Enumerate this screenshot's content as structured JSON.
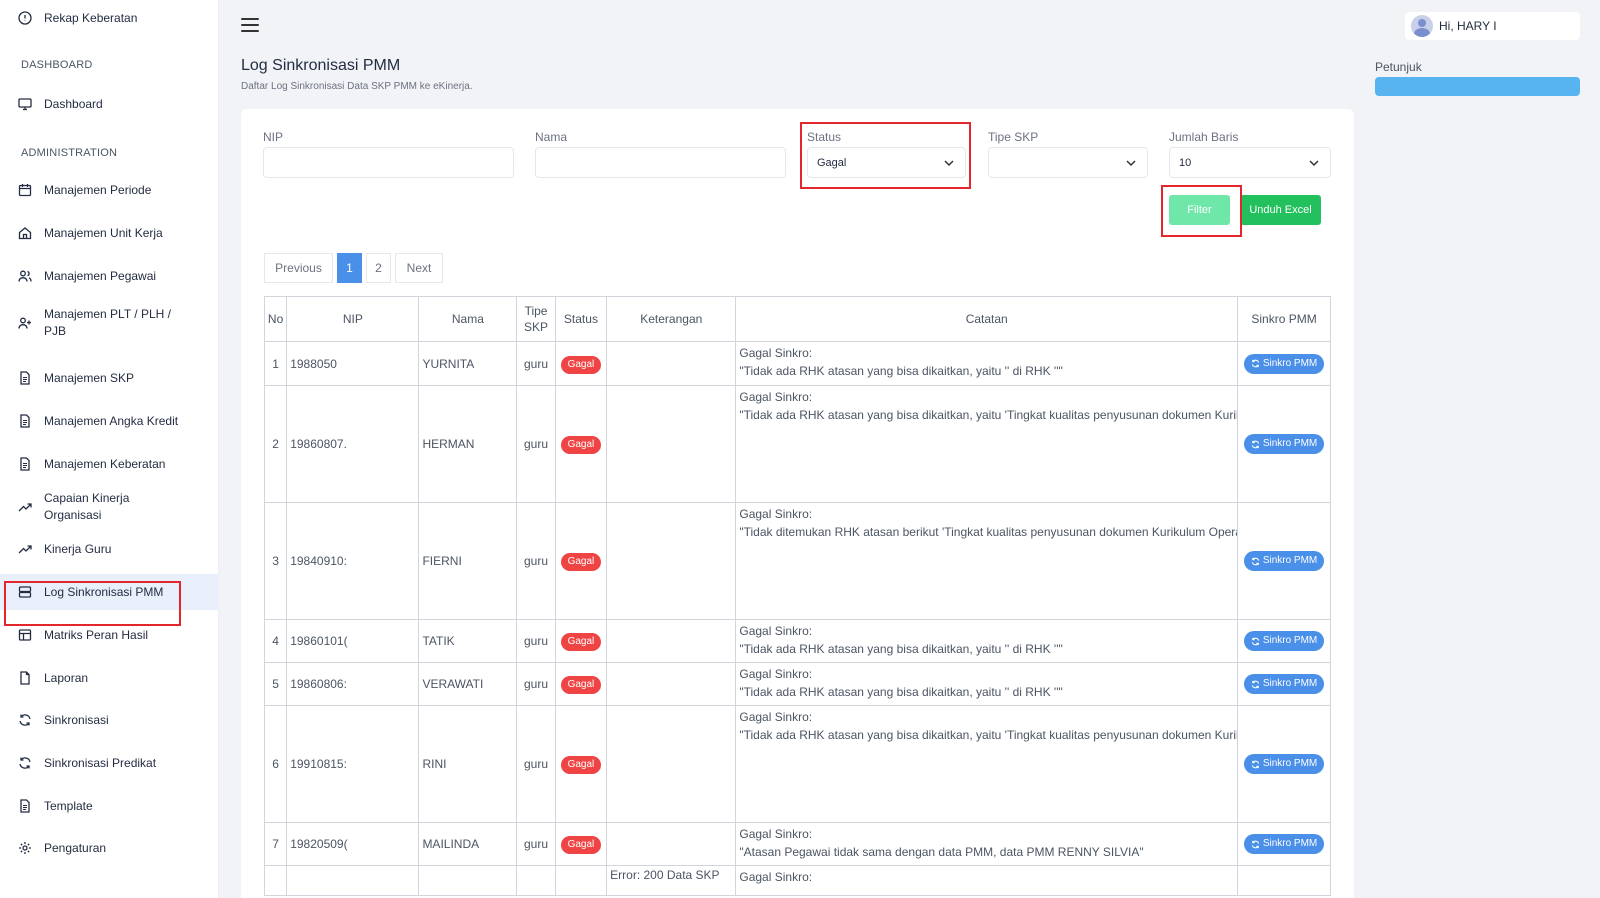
{
  "sidebar": {
    "items": [
      {
        "label": "Rekap Keberatan",
        "icon": "alert-circle-icon"
      },
      {
        "label": "Dashboard",
        "icon": "monitor-icon"
      },
      {
        "label": "Manajemen Periode",
        "icon": "calendar-icon"
      },
      {
        "label": "Manajemen Unit Kerja",
        "icon": "home-icon"
      },
      {
        "label": "Manajemen Pegawai",
        "icon": "users-icon"
      },
      {
        "label": "Manajemen PLT / PLH / PJB",
        "icon": "user-plus-icon"
      },
      {
        "label": "Manajemen SKP",
        "icon": "file-text-icon"
      },
      {
        "label": "Manajemen Angka Kredit",
        "icon": "file-text-icon"
      },
      {
        "label": "Manajemen Keberatan",
        "icon": "file-text-icon"
      },
      {
        "label": "Capaian Kinerja Organisasi",
        "icon": "trending-up-icon"
      },
      {
        "label": "Kinerja Guru",
        "icon": "trending-up-icon"
      },
      {
        "label": "Log Sinkronisasi PMM",
        "icon": "server-icon"
      },
      {
        "label": "Matriks Peran Hasil",
        "icon": "table-icon"
      },
      {
        "label": "Laporan",
        "icon": "file-icon"
      },
      {
        "label": "Sinkronisasi",
        "icon": "refresh-icon"
      },
      {
        "label": "Sinkronisasi Predikat",
        "icon": "refresh-icon"
      },
      {
        "label": "Template",
        "icon": "file-text-icon"
      },
      {
        "label": "Pengaturan",
        "icon": "gear-icon"
      }
    ],
    "sections": {
      "dashboard": "DASHBOARD",
      "administration": "ADMINISTRATION"
    }
  },
  "header": {
    "user_greeting": "Hi, HARY I"
  },
  "page": {
    "title": "Log Sinkronisasi PMM",
    "subtitle": "Daftar Log Sinkronisasi Data SKP PMM ke eKinerja.",
    "petunjuk": "Petunjuk"
  },
  "filters": {
    "nip_label": "NIP",
    "nip_value": "",
    "nama_label": "Nama",
    "nama_value": "",
    "status_label": "Status",
    "status_value": "Gagal",
    "tipe_label": "Tipe SKP",
    "tipe_value": "",
    "jumlah_label": "Jumlah Baris",
    "jumlah_value": "10",
    "filter_button": "Filter",
    "excel_button": "Unduh Excel"
  },
  "pagination": {
    "previous": "Previous",
    "pages": [
      "1",
      "2"
    ],
    "next": "Next",
    "active_page": "1"
  },
  "table": {
    "headers": {
      "no": "No",
      "nip": "NIP",
      "nama": "Nama",
      "tipe": "Tipe SKP",
      "status": "Status",
      "keterangan": "Keterangan",
      "catatan": "Catatan",
      "sinkro": "Sinkro PMM"
    },
    "sinkro_label": "Sinkro PMM",
    "rows": [
      {
        "no": "1",
        "nip": "1988050",
        "nama": "YURNITA",
        "tipe": "guru",
        "status": "Gagal",
        "keterangan": "",
        "catatan_title": "Gagal Sinkro:",
        "catatan": "\"Tidak ada RHK atasan yang bisa dikaitkan, yaitu '' di RHK ''\""
      },
      {
        "no": "2",
        "nip": "19860807.",
        "nama": "HERMAN",
        "tipe": "guru",
        "status": "Gagal",
        "keterangan": "",
        "catatan_title": "Gagal Sinkro:",
        "catatan": "\"Tidak ada RHK atasan yang bisa dikaitkan, yaitu 'Tingkat kualitas penyusunan dokumen Kurikulum Operasional Satuan Pendidikan (KOSP) yang berorientasi pada peningkatan pembelajaran sesuai standar yang digunakan' di RHK 'Tersusunnya Kurikulum Operasional Satuan Pendidikan (KOSP) sebagai acuan dalam peningkatan pembelajaran'\""
      },
      {
        "no": "3",
        "nip": "19840910:",
        "nama": "FIERNI",
        "tipe": "guru",
        "status": "Gagal",
        "keterangan": "",
        "catatan_title": "Gagal Sinkro:",
        "catatan": "\"Tidak ditemukan RHK atasan berikut 'Tingkat kualitas penyusunan dokumen Kurikulum Operasional Satuan Pendidikan (KOSP) yang berorientasi pada peningkatan pembelajaran sesuai standar yang digunakan' di RHK 'Tersusunnya Kurikulum Operasional Satuan Pendidikan (KOSP) sebagai acuan dalam peningkatan pembelajaran'\""
      },
      {
        "no": "4",
        "nip": "19860101(",
        "nama": "TATIK",
        "tipe": "guru",
        "status": "Gagal",
        "keterangan": "",
        "catatan_title": "Gagal Sinkro:",
        "catatan": "\"Tidak ada RHK atasan yang bisa dikaitkan, yaitu '' di RHK ''\""
      },
      {
        "no": "5",
        "nip": "19860806:",
        "nama": "VERAWATI",
        "tipe": "guru",
        "status": "Gagal",
        "keterangan": "",
        "catatan_title": "Gagal Sinkro:",
        "catatan": "\"Tidak ada RHK atasan yang bisa dikaitkan, yaitu '' di RHK ''\""
      },
      {
        "no": "6",
        "nip": "19910815:",
        "nama": "RINI",
        "tipe": "guru",
        "status": "Gagal",
        "keterangan": "",
        "catatan_title": "Gagal Sinkro:",
        "catatan": "\"Tidak ada RHK atasan yang bisa dikaitkan, yaitu 'Tingkat kualitas penyusunan dokumen Kurikulum Operasional Satuan Pendidikan (KOSP) yang berorientasi pada peningkatan pembelajaran sesuai standar yang digunakan' di RHK 'Tersusunnya Kurikulum Operasional Satuan Pendidikan (KOSP) sebagai acuan dalam peningkatan pembelajaran'\""
      },
      {
        "no": "7",
        "nip": "19820509(",
        "nama": "MAILINDA",
        "tipe": "guru",
        "status": "Gagal",
        "keterangan": "",
        "catatan_title": "Gagal Sinkro:",
        "catatan": "\"Atasan Pegawai tidak sama dengan data PMM, data PMM RENNY SILVIA\""
      },
      {
        "no": "",
        "nip": "",
        "nama": "",
        "tipe": "",
        "status": "",
        "keterangan": "Error: 200 Data SKP",
        "catatan_title": "Gagal Sinkro:",
        "catatan": ""
      }
    ]
  }
}
